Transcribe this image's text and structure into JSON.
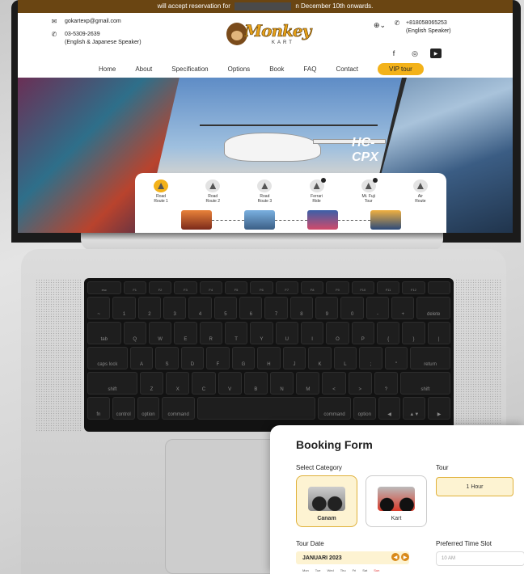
{
  "banner": {
    "left": "will accept reservation for",
    "right": "n December 10th onwards."
  },
  "contact": {
    "email": "gokartexp@gmail.com",
    "phone_jp": "03-5309-2639",
    "phone_jp_note": "(English & Japanese Speaker)",
    "phone_intl": "+818058065253",
    "phone_intl_note": "(English Speaker)"
  },
  "logo": {
    "name": "Monkey",
    "sub": "KART"
  },
  "nav": {
    "items": [
      "Home",
      "About",
      "Specification",
      "Options",
      "Book",
      "FAQ",
      "Contact"
    ],
    "vip": "VIP tour"
  },
  "hero": {
    "registration": "HC-CPX"
  },
  "routes": [
    {
      "l1": "Road",
      "l2": "Route 1"
    },
    {
      "l1": "Road",
      "l2": "Route 2"
    },
    {
      "l1": "Road",
      "l2": "Route 3"
    },
    {
      "l1": "Ferrari",
      "l2": "Ride"
    },
    {
      "l1": "Mt. Fuji",
      "l2": "Tour"
    },
    {
      "l1": "Air",
      "l2": "Route"
    }
  ],
  "keyboard": {
    "fn_row": [
      "esc",
      "F1",
      "F2",
      "F3",
      "F4",
      "F5",
      "F6",
      "F7",
      "F8",
      "F9",
      "F10",
      "F11",
      "F12",
      ""
    ],
    "num_row": [
      "~",
      "1",
      "2",
      "3",
      "4",
      "5",
      "6",
      "7",
      "8",
      "9",
      "0",
      "-",
      "+",
      "delete"
    ],
    "q_row": [
      "tab",
      "Q",
      "W",
      "E",
      "R",
      "T",
      "Y",
      "U",
      "I",
      "O",
      "P",
      "{",
      "}",
      "|"
    ],
    "a_row": [
      "caps lock",
      "A",
      "S",
      "D",
      "F",
      "G",
      "H",
      "J",
      "K",
      "L",
      ";",
      "\"",
      "return"
    ],
    "z_row": [
      "shift",
      "Z",
      "X",
      "C",
      "V",
      "B",
      "N",
      "M",
      "<",
      ">",
      "?",
      "shift"
    ],
    "bottom_row": [
      "fn",
      "control",
      "option",
      "command",
      "",
      "command",
      "option",
      "◀",
      "▲▼",
      "▶"
    ]
  },
  "booking": {
    "title": "Booking Form",
    "select_category": "Select Category",
    "cat_canam": "Canam",
    "cat_kart": "Kart",
    "tour_label": "Tour",
    "tour_value": "1 Hour",
    "date_label": "Tour Date",
    "month": "JANUARI 2023",
    "weekdays": [
      "Mon",
      "Tue",
      "Wed",
      "Thu",
      "Fri",
      "Sat",
      "Sun"
    ],
    "time_label": "Preferred Time Slot",
    "time_value": "10 AM"
  },
  "colors": {
    "accent": "#f3b21a",
    "brand_brown": "#6a4512",
    "selected_bg": "#fdf3d2"
  }
}
